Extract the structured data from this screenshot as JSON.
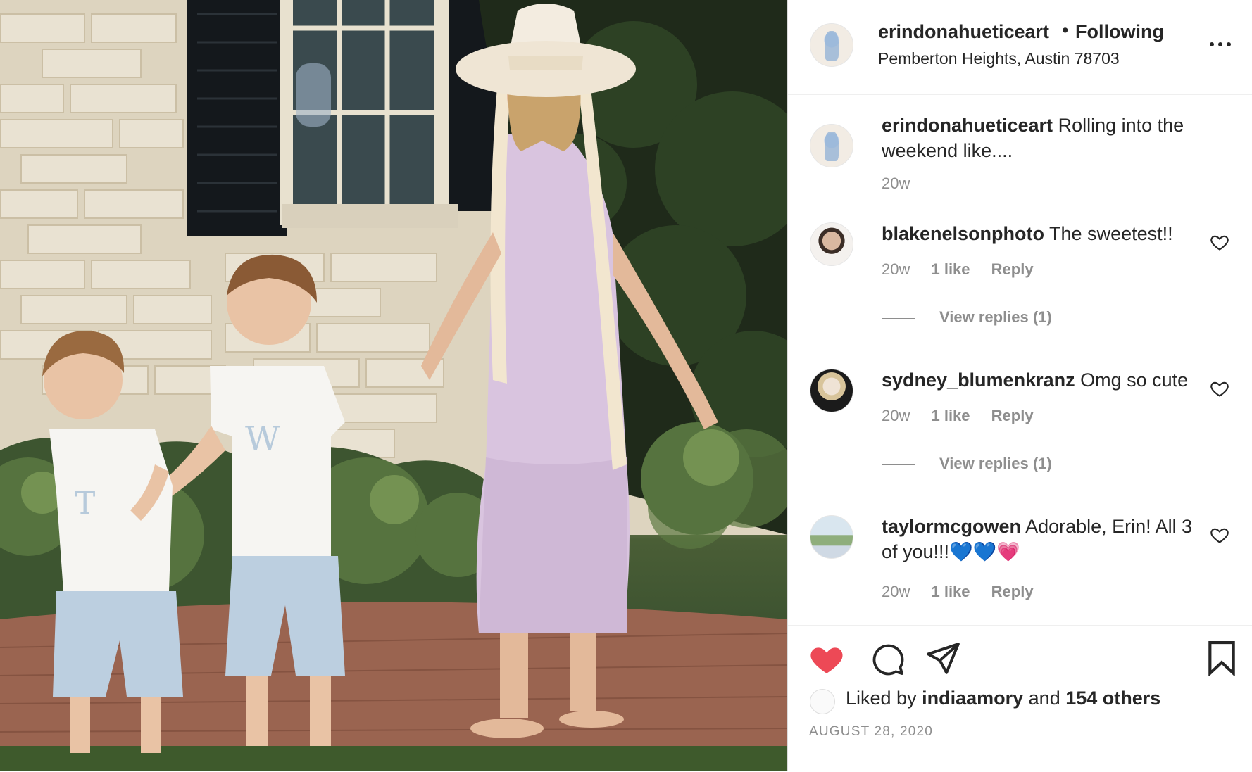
{
  "post": {
    "username": "erindonahueticeart",
    "follow_separator": "•",
    "follow_label": "Following",
    "location": "Pemberton Heights, Austin 78703",
    "more_icon": "more-options-icon",
    "caption": {
      "username": "erindonahueticeart",
      "text": "Rolling into the weekend like....",
      "time": "20w"
    },
    "comments": [
      {
        "username": "blakenelsonphoto",
        "text": "The sweetest!!",
        "time": "20w",
        "likes": "1 like",
        "reply": "Reply",
        "view_replies": "View replies (1)"
      },
      {
        "username": "sydney_blumenkranz",
        "text": "Omg so cute",
        "time": "20w",
        "likes": "1 like",
        "reply": "Reply",
        "view_replies": "View replies (1)"
      },
      {
        "username": "taylormcgowen",
        "text": "Adorable, Erin! All 3 of you!!!💙💙💗",
        "time": "20w",
        "likes": "1 like",
        "reply": "Reply"
      }
    ],
    "actions": {
      "like_icon": "heart-filled-icon",
      "comment_icon": "comment-icon",
      "share_icon": "share-icon",
      "save_icon": "bookmark-icon"
    },
    "liked_by": {
      "prefix": "Liked by",
      "user": "indiaamory",
      "connector": "and",
      "others": "154 others"
    },
    "date": "AUGUST 28, 2020",
    "colors": {
      "like": "#ed4956",
      "text": "#262626",
      "muted": "#8e8e8e",
      "border": "#dbdbdb"
    }
  }
}
